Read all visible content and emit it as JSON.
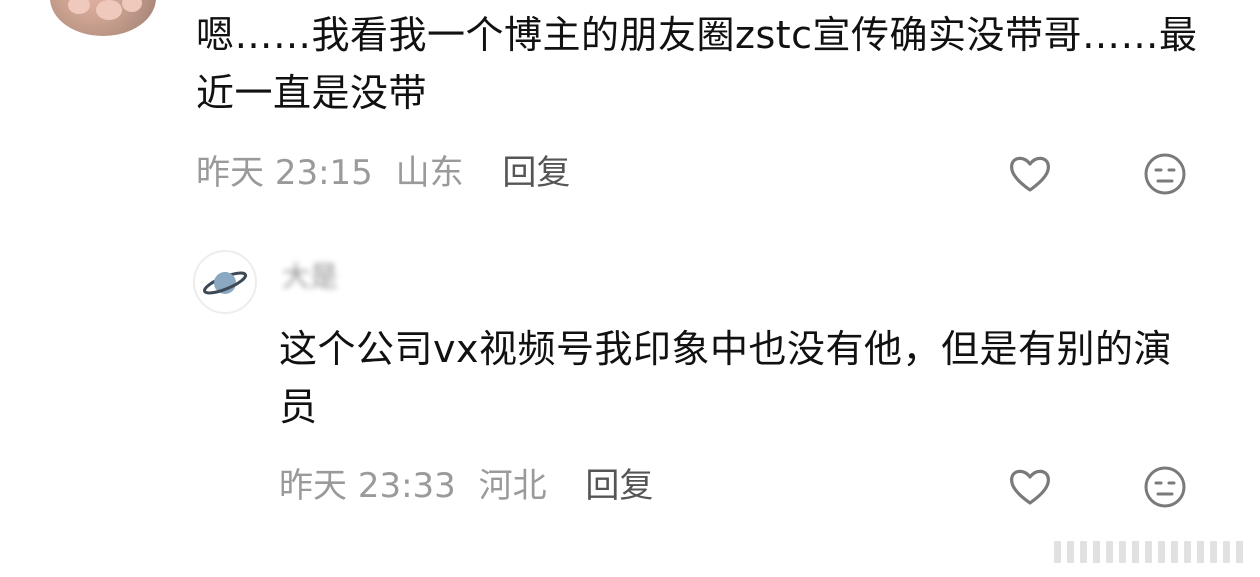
{
  "comments": [
    {
      "text": "嗯……我看我一个博主的朋友圈zstc宣传确实没带哥……最近一直是没带",
      "date": "昨天",
      "time": "23:15",
      "location": "山东",
      "reply_label": "回复",
      "like_icon": "heart-outline",
      "emoji_icon": "neutral-face"
    },
    {
      "username": "大是",
      "avatar_icon": "planet-saturn",
      "text": "这个公司vx视频号我印象中也没有他，但是有别的演员",
      "date": "昨天",
      "time": "23:33",
      "location": "河北",
      "reply_label": "回复",
      "like_icon": "heart-outline",
      "emoji_icon": "neutral-face"
    }
  ],
  "colors": {
    "text": "#111111",
    "meta": "#9a9a9a",
    "reply": "#555555",
    "icon": "#7a7a7a"
  }
}
